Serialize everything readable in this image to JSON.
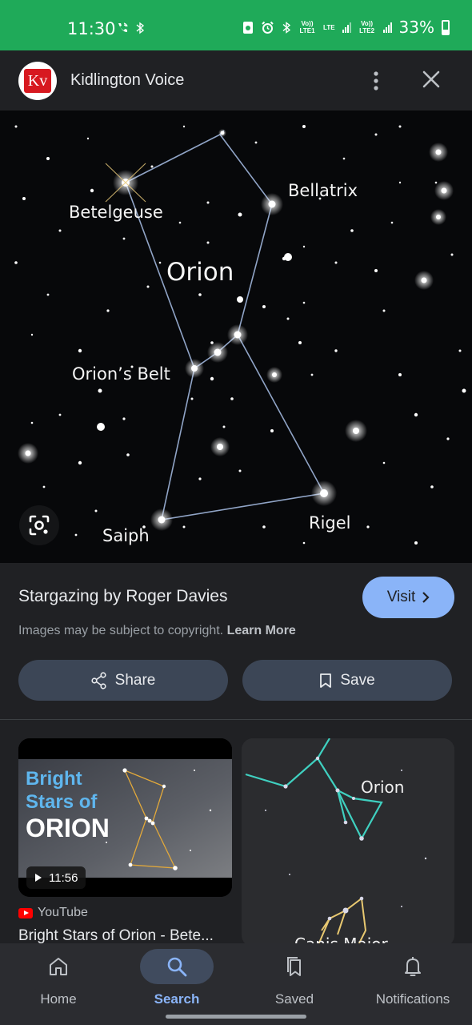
{
  "status_bar": {
    "time": "11:30",
    "battery": "33%",
    "volte1": "Vo)) LTE1",
    "volte2": "Vo)) LTE2",
    "lte": "LTE",
    "icons": [
      "wifi-call-icon",
      "bluetooth-icon",
      "alarm-icon",
      "signal-icon",
      "battery-icon"
    ]
  },
  "header": {
    "site_logo": "Kv",
    "site_name": "Kidlington Voice",
    "more_icon": "more-vert-icon",
    "close_icon": "close-icon"
  },
  "hero_image": {
    "labels": {
      "betelgeuse": "Betelgeuse",
      "bellatrix": "Bellatrix",
      "orion": "Orion",
      "belt": "Orion’s Belt",
      "saiph": "Saiph",
      "rigel": "Rigel"
    }
  },
  "info": {
    "title": "Stargazing by Roger Davies",
    "visit_label": "Visit",
    "copyright_text": "Images may be subject to copyright.",
    "learn_more": "Learn More",
    "share_label": "Share",
    "save_label": "Save"
  },
  "results": [
    {
      "thumb_line1": "Bright",
      "thumb_line2": "Stars of",
      "thumb_line3": "ORION",
      "duration": "11:56",
      "source": "YouTube",
      "title": "Bright Stars of Orion - Bete..."
    },
    {
      "label1": "Orion",
      "label2": "Canis Major"
    }
  ],
  "bottom_nav": [
    {
      "label": "Home",
      "icon": "home-icon",
      "active": false
    },
    {
      "label": "Search",
      "icon": "search-icon",
      "active": true
    },
    {
      "label": "Saved",
      "icon": "bookmarks-icon",
      "active": false
    },
    {
      "label": "Notifications",
      "icon": "bell-icon",
      "active": false
    }
  ],
  "colors": {
    "status_bar": "#1faa59",
    "accent": "#8ab4f8",
    "background": "#202124",
    "chip": "#3c4656"
  }
}
